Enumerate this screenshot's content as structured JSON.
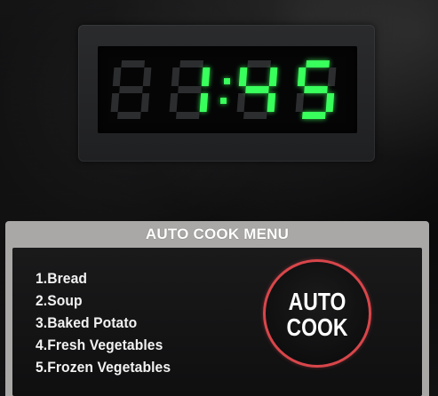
{
  "display": {
    "time": "1:45",
    "color": "#39ff5c"
  },
  "auto_cook_menu": {
    "title": "AUTO COOK MENU",
    "items": [
      "1.Bread",
      "2.Soup",
      "3.Baked Potato",
      "4.Fresh Vegetables",
      "5.Frozen Vegetables"
    ]
  },
  "auto_cook_button": {
    "line1": "AUTO",
    "line2": "COOK",
    "ring_color": "#d8464a"
  }
}
